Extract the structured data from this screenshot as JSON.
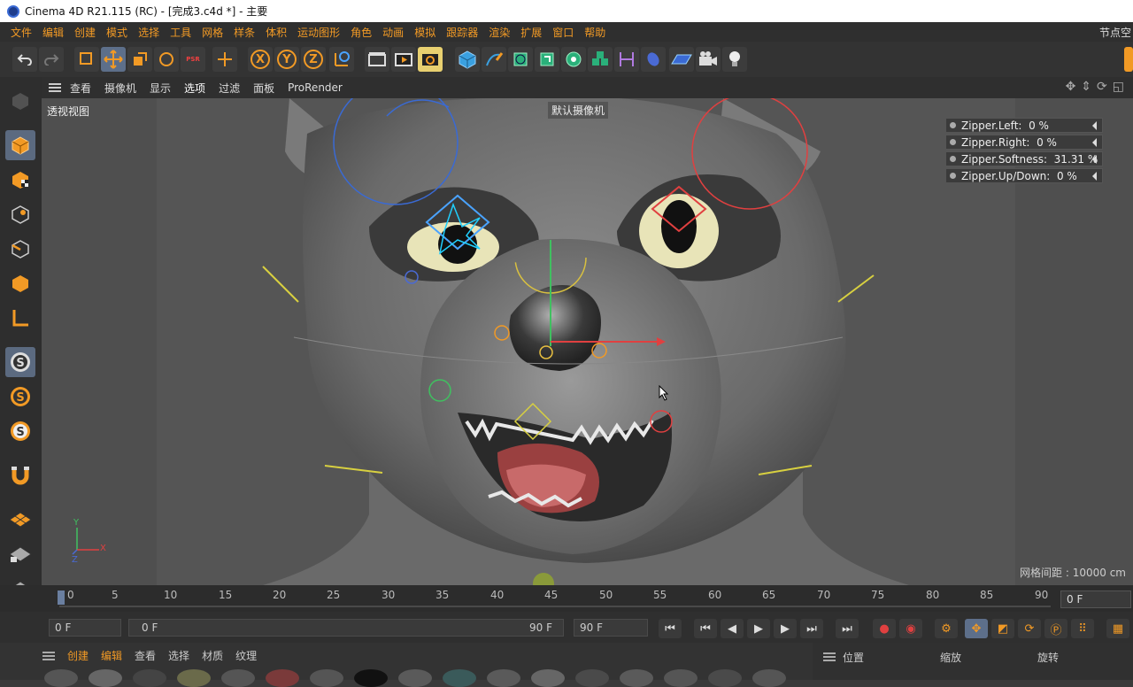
{
  "window": {
    "title": "Cinema 4D R21.115 (RC) - [完成3.c4d *] - 主要"
  },
  "menu": {
    "items": [
      "文件",
      "编辑",
      "创建",
      "模式",
      "选择",
      "工具",
      "网格",
      "样条",
      "体积",
      "运动图形",
      "角色",
      "动画",
      "模拟",
      "跟踪器",
      "渲染",
      "扩展",
      "窗口",
      "帮助"
    ],
    "right_label": "节点空"
  },
  "toolbar": {
    "axis_x": "X",
    "axis_y": "Y",
    "axis_z": "Z",
    "psr": "PSR"
  },
  "viewport": {
    "menu": [
      "查看",
      "摄像机",
      "显示",
      "选项",
      "过滤",
      "面板",
      "ProRender"
    ],
    "active_menu": "选项",
    "title": "透视视图",
    "camera_label": "默认摄像机",
    "grid_label": "网格间距 : 10000 cm",
    "axis_y": "Y",
    "axis_x": "X",
    "axis_z": "Z"
  },
  "sliders": [
    {
      "name": "Zipper.Left:",
      "value": "0 %"
    },
    {
      "name": "Zipper.Right:",
      "value": "0 %"
    },
    {
      "name": "Zipper.Softness:",
      "value": "31.31 %"
    },
    {
      "name": "Zipper.Up/Down:",
      "value": "0 %"
    }
  ],
  "timeline": {
    "ticks": [
      "0",
      "5",
      "10",
      "15",
      "20",
      "25",
      "30",
      "35",
      "40",
      "45",
      "50",
      "55",
      "60",
      "65",
      "70",
      "75",
      "80",
      "85",
      "90"
    ],
    "current_frame": "0 F"
  },
  "transport": {
    "start": "0 F",
    "range_start": "0 F",
    "range_end": "90 F",
    "end": "90 F"
  },
  "bottom": {
    "menu": [
      "创建",
      "编辑",
      "查看",
      "选择",
      "材质",
      "纹理"
    ],
    "attr_headers": [
      "位置",
      "缩放",
      "旋转"
    ]
  },
  "colors": {
    "accent": "#f29a25",
    "selected": "#5d6f8a"
  }
}
